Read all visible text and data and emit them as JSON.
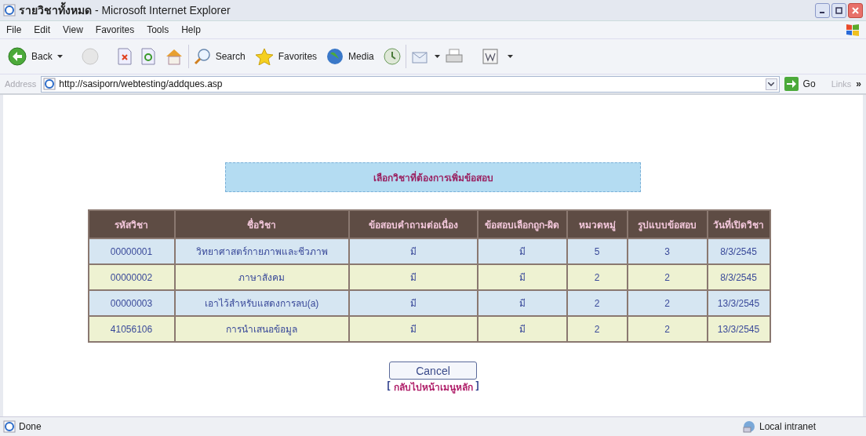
{
  "window": {
    "title_bold": "รายวิชาทั้งหมด",
    "title_rest": " - Microsoft Internet Explorer"
  },
  "menu_bar": [
    "File",
    "Edit",
    "View",
    "Favorites",
    "Tools",
    "Help"
  ],
  "toolbar": [
    {
      "label": "Back"
    },
    {
      "label": "Search"
    },
    {
      "label": "Favorites"
    },
    {
      "label": "Media"
    }
  ],
  "address_bar": {
    "label": "Address",
    "url": "http://sasiporn/webtesting/addques.asp",
    "go": "Go",
    "links": "Links",
    "more": "»"
  },
  "page": {
    "heading": "เลือกวิชาที่ต้องการเพิ่มข้อสอบ",
    "table": {
      "columns": [
        "รหัสวิชา",
        "ชื่อวิชา",
        "ข้อสอบคำถามต่อเนื่อง",
        "ข้อสอบเลือกถูก-ผิด",
        "หมวดหมู่",
        "รูปแบบข้อสอบ",
        "วันที่เปิดวิชา"
      ],
      "rows": [
        [
          "00000001",
          "วิทยาศาสตร์กายภาพและชีวภาพ",
          "มี",
          "มี",
          "5",
          "3",
          "8/3/2545"
        ],
        [
          "00000002",
          "ภาษาสังคม",
          "มี",
          "มี",
          "2",
          "2",
          "8/3/2545"
        ],
        [
          "00000003",
          "เอาไว้สำหรับแสดงการลบ(a)",
          "มี",
          "มี",
          "2",
          "2",
          "13/3/2545"
        ],
        [
          "41056106",
          "การนำเสนอข้อมูล",
          "มี",
          "มี",
          "2",
          "2",
          "13/3/2545"
        ]
      ]
    },
    "cancel_button": "Cancel",
    "back_link": "กลับไปหน้าเมนูหลัก",
    "bracket_open": "[",
    "bracket_close": "]"
  },
  "status_bar": {
    "status": "Done",
    "zone": "Local intranet"
  }
}
